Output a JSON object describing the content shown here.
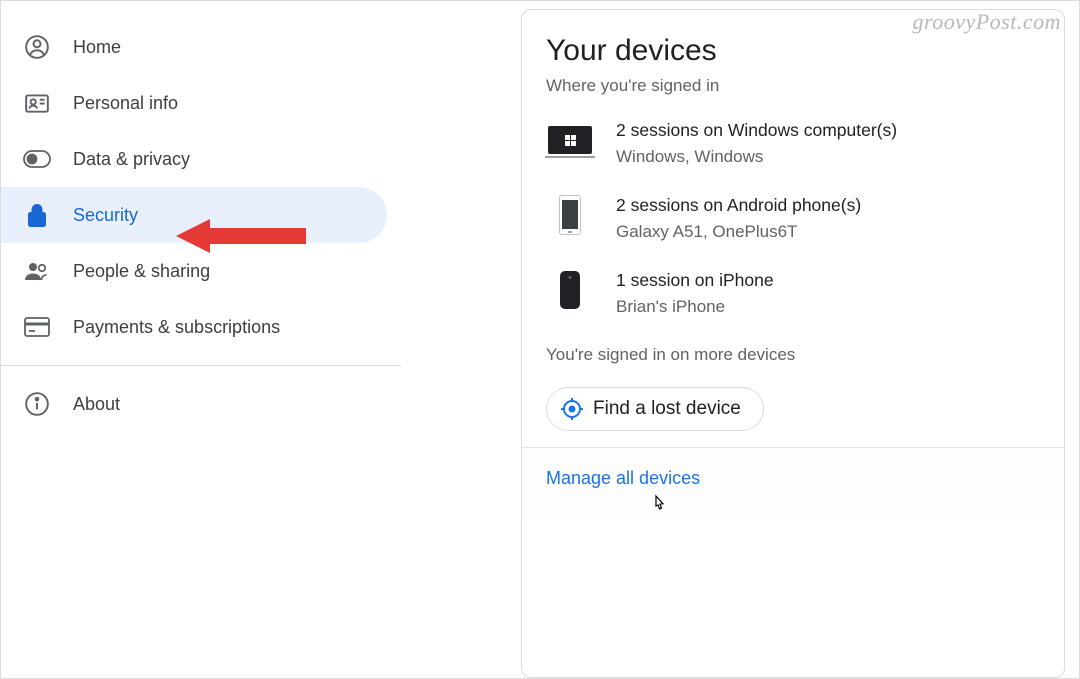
{
  "watermark": "groovyPost.com",
  "sidebar": {
    "items": [
      {
        "label": "Home"
      },
      {
        "label": "Personal info"
      },
      {
        "label": "Data & privacy"
      },
      {
        "label": "Security"
      },
      {
        "label": "People & sharing"
      },
      {
        "label": "Payments & subscriptions"
      },
      {
        "label": "About"
      }
    ]
  },
  "card": {
    "title": "Your devices",
    "subtitle": "Where you're signed in",
    "devices": [
      {
        "main": "2 sessions on Windows computer(s)",
        "sub": "Windows, Windows"
      },
      {
        "main": "2 sessions on Android phone(s)",
        "sub": "Galaxy A51, OnePlus6T"
      },
      {
        "main": "1 session on iPhone",
        "sub": "Brian's iPhone"
      }
    ],
    "more": "You're signed in on more devices",
    "find_button": "Find a lost device",
    "footer_link": "Manage all devices"
  }
}
